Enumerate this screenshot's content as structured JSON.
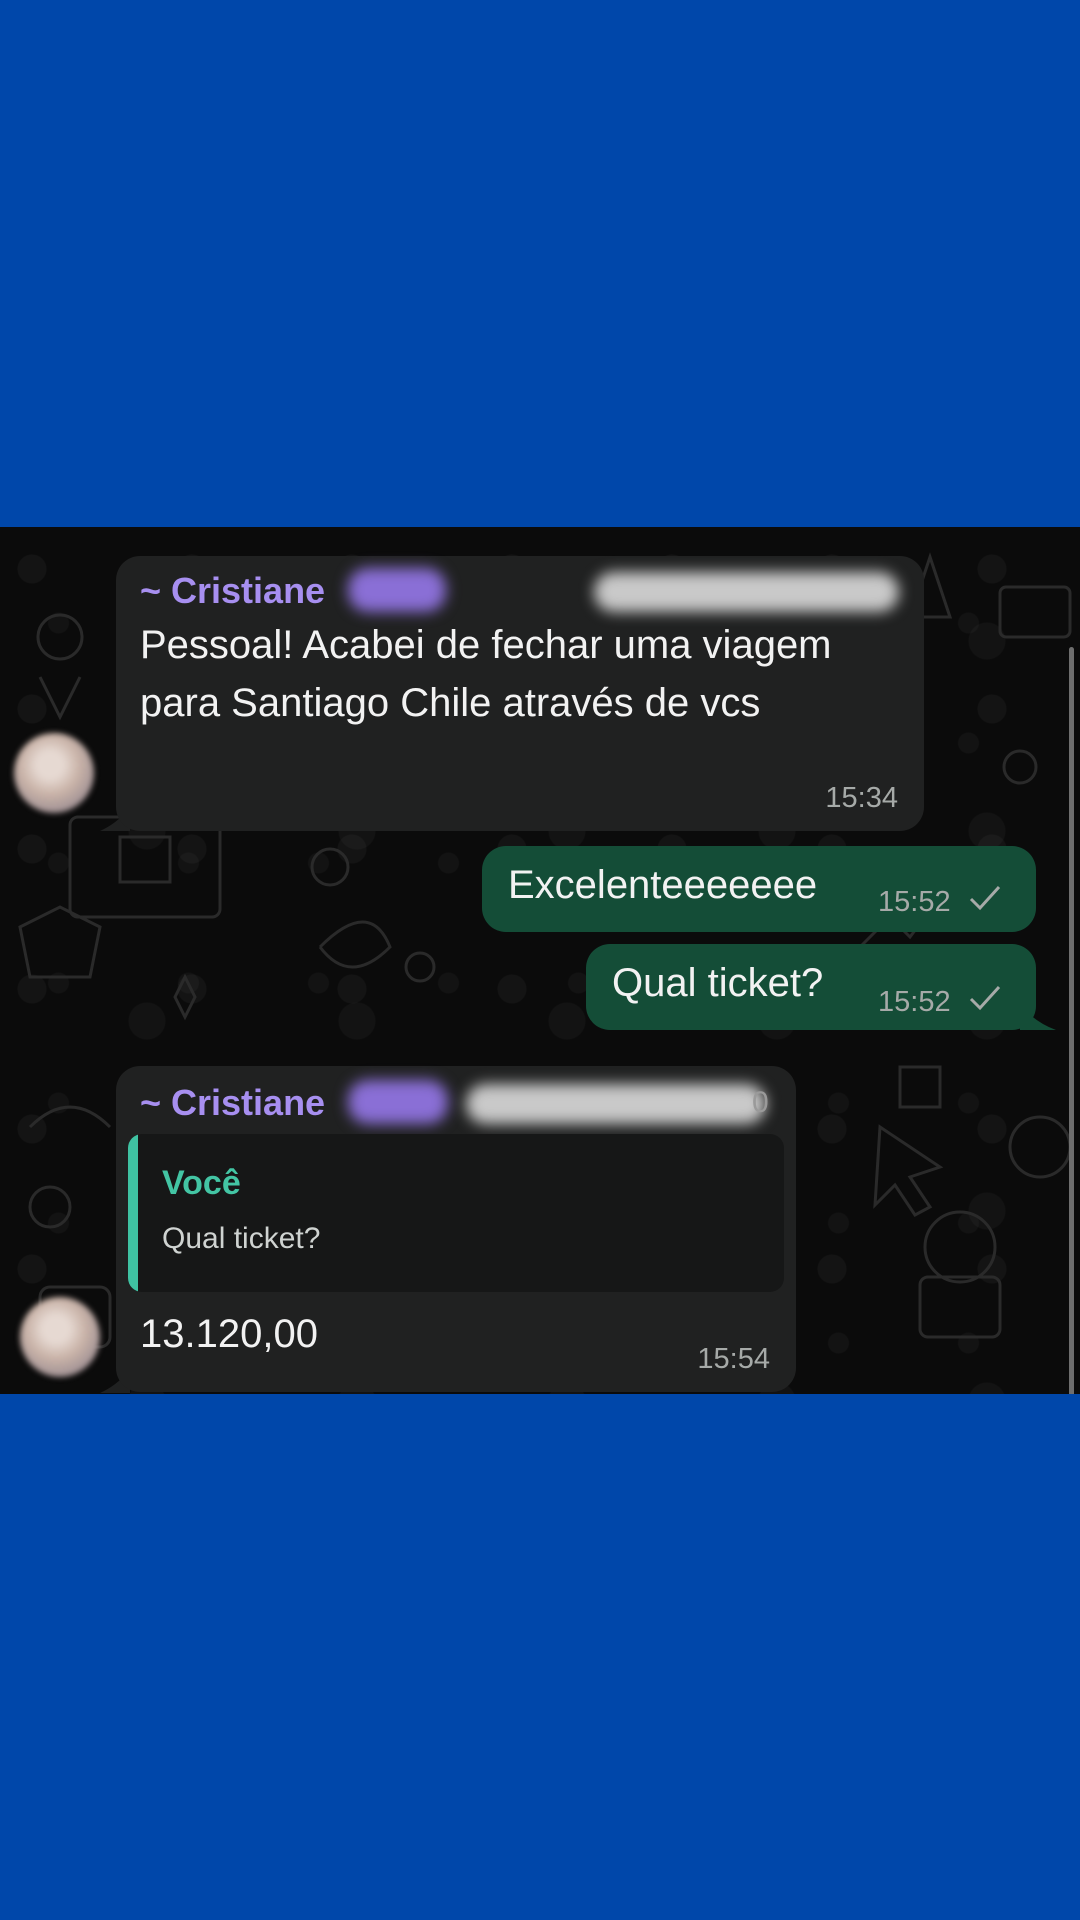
{
  "messages": [
    {
      "type": "incoming",
      "sender": "~ Cristiane",
      "text": "Pessoal! Acabei de fechar uma viagem para Santiago Chile através de vcs",
      "time": "15:34"
    },
    {
      "type": "outgoing",
      "text": "Excelenteeeeeee",
      "time": "15:52",
      "status": "sent-check-icon"
    },
    {
      "type": "outgoing",
      "text": "Qual ticket?",
      "time": "15:52",
      "status": "sent-check-icon"
    },
    {
      "type": "incoming",
      "sender": "~ Cristiane",
      "sender_suffix": "0",
      "reply": {
        "author": "Você",
        "text": "Qual ticket?"
      },
      "text": "13.120,00",
      "time": "15:54"
    }
  ],
  "colors": {
    "background_frame": "#0047aa",
    "chat_background": "#0b0b0b",
    "incoming_bubble": "#202121",
    "outgoing_bubble": "#144d37",
    "sender_name": "#a78ff0",
    "reply_accent": "#43c5a4"
  }
}
